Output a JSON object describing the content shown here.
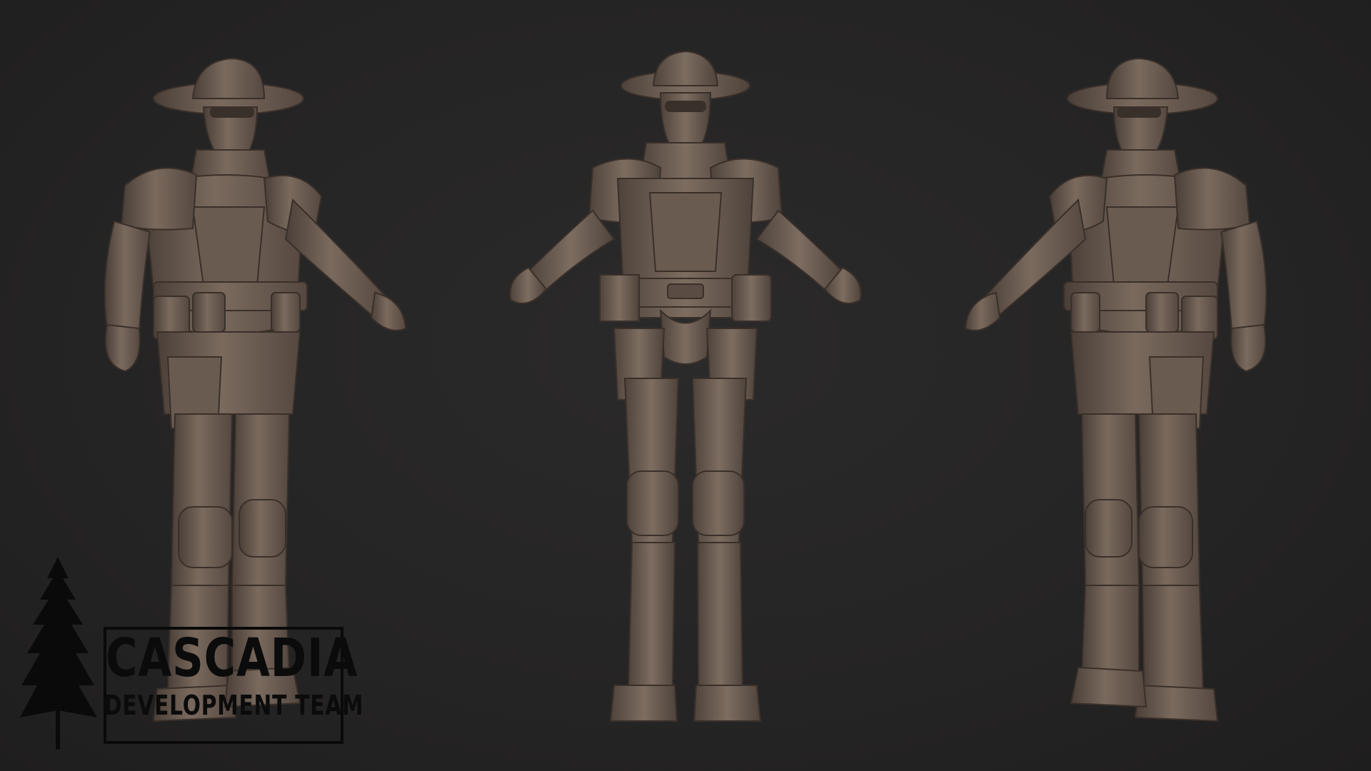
{
  "scene": {
    "background_color": "#262525",
    "sculpt_color": "#6f6156",
    "sculpt_shadow": "#3f352f",
    "sculpt_highlight": "#8d7d70"
  },
  "figures": [
    {
      "view": "three-quarter-left"
    },
    {
      "view": "front"
    },
    {
      "view": "three-quarter-right"
    }
  ],
  "logo": {
    "title": "CASCADIA",
    "subtitle": "DEVELOPMENT TEAM",
    "icon": "pine-tree-icon",
    "color": "#0b0b0b"
  }
}
